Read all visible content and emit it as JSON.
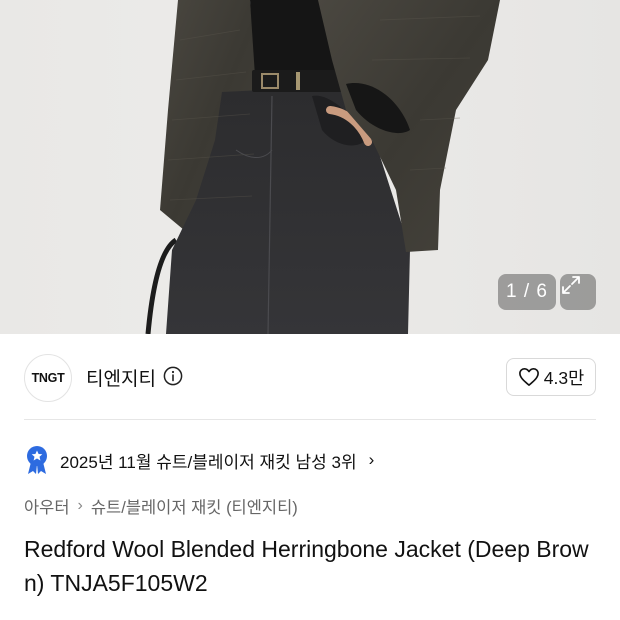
{
  "gallery": {
    "pager_text": "1 / 6",
    "expand_icon": "expand-icon"
  },
  "brand": {
    "logo_text": "TNGT",
    "name": "티엔지티",
    "info_icon": "info-icon",
    "like_icon": "heart-icon",
    "like_count": "4.3만"
  },
  "ranking": {
    "badge_icon": "star-badge-icon",
    "text": "2025년 11월 슈트/블레이저 재킷 남성 3위",
    "chevron": "›",
    "badge_color": "#2d6be0"
  },
  "breadcrumb": {
    "items": [
      "아우터",
      "슈트/블레이저 재킷 (티엔지티)"
    ],
    "separator": "›"
  },
  "product": {
    "title": "Redford Wool Blended Herringbone Jacket (Deep Brown) TNJA5F105W2"
  }
}
